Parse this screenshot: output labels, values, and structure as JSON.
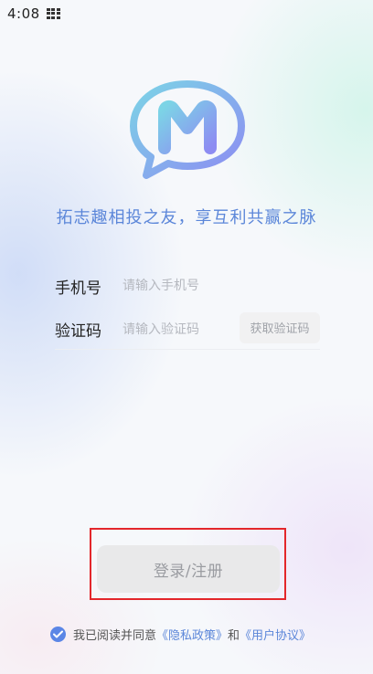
{
  "status_bar": {
    "time": "4:08",
    "icon": "app-grid-icon"
  },
  "brand": {
    "logo_icon": "m-chat-bubble-logo-icon",
    "logo_letter": "M",
    "slogan": "拓志趣相投之友，享互利共赢之脉",
    "colors": {
      "gradient_start": "#7ad3e6",
      "gradient_end": "#8a8df0",
      "slogan": "#5b86d9"
    }
  },
  "form": {
    "phone_label": "手机号",
    "phone_placeholder": "请输入手机号",
    "phone_value": "",
    "code_label": "验证码",
    "code_placeholder": "请输入验证码",
    "code_value": "",
    "get_code_label": "获取验证码"
  },
  "login": {
    "button_label": "登录/注册"
  },
  "agreement": {
    "checked": true,
    "check_icon": "checkmark-circle-icon",
    "prefix": "我已阅读并同意",
    "privacy_link": "《隐私政策》",
    "conjunction": "和",
    "user_agreement_link": "《用户协议》"
  }
}
